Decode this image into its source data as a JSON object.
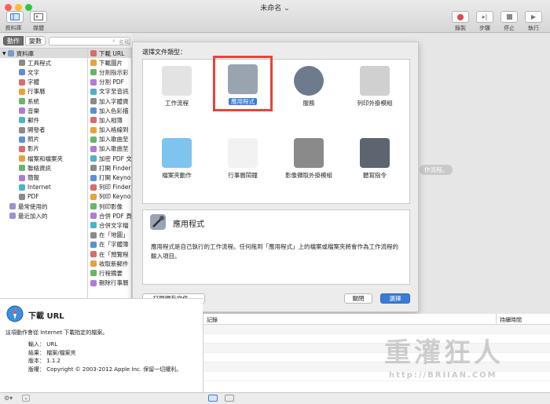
{
  "window": {
    "title": "未命名"
  },
  "toolbar": {
    "library_label": "資料庫",
    "media_label": "媒體",
    "record_label": "錄製",
    "step_label": "步驟",
    "stop_label": "停止",
    "run_label": "執行"
  },
  "sidebar": {
    "tab_actions": "動作",
    "tab_variables": "變數",
    "search_placeholder": "名稱",
    "root_label": "資料庫",
    "categories": [
      {
        "label": "工具程式",
        "icon": "utility-icon"
      },
      {
        "label": "文字",
        "icon": "text-icon"
      },
      {
        "label": "字體",
        "icon": "font-icon"
      },
      {
        "label": "行事曆",
        "icon": "calendar-icon"
      },
      {
        "label": "系統",
        "icon": "system-icon"
      },
      {
        "label": "音樂",
        "icon": "music-icon"
      },
      {
        "label": "郵件",
        "icon": "mail-icon"
      },
      {
        "label": "開發者",
        "icon": "developer-icon"
      },
      {
        "label": "照片",
        "icon": "photo-icon"
      },
      {
        "label": "影片",
        "icon": "movie-icon"
      },
      {
        "label": "檔案和檔案夾",
        "icon": "finder-icon"
      },
      {
        "label": "聯絡資訊",
        "icon": "contacts-icon"
      },
      {
        "label": "簡報",
        "icon": "presentation-icon"
      },
      {
        "label": "Internet",
        "icon": "internet-icon"
      },
      {
        "label": "PDF",
        "icon": "pdf-icon"
      }
    ],
    "smart": [
      {
        "label": "最常使用的",
        "icon": "folder-icon"
      },
      {
        "label": "最近加入的",
        "icon": "folder-icon"
      }
    ],
    "actions": [
      "下載 URL",
      "下載圖片",
      "分割指示彩",
      "分割 PDF",
      "文字至音訊",
      "加入字體資",
      "加入色彩描",
      "加入相簿",
      "加入格線到",
      "加入歌曲至",
      "加入歌曲至",
      "加密 PDF 文",
      "打開 Finder",
      "打開 Keyno",
      "列印 Finder",
      "列印 Keyno",
      "列印影像",
      "合併 PDF 頁",
      "合併文字檔",
      "在「地圖」",
      "在「字體簿",
      "在「預覽程",
      "收取新郵件",
      "行程摘要",
      "刪除行事曆"
    ]
  },
  "dialog": {
    "heading": "選擇文件類型：",
    "types": [
      {
        "label": "工作流程",
        "icon": "workflow-icon"
      },
      {
        "label": "應用程式",
        "icon": "application-icon",
        "selected": true
      },
      {
        "label": "服務",
        "icon": "gear-icon"
      },
      {
        "label": "列印外掛模組",
        "icon": "printer-icon"
      },
      {
        "label": "檔案夾動作",
        "icon": "folder-icon"
      },
      {
        "label": "行事曆鬧鐘",
        "icon": "calendar-icon"
      },
      {
        "label": "影像擷取外掛模組",
        "icon": "camera-icon"
      },
      {
        "label": "聽寫指令",
        "icon": "microphone-icon"
      }
    ],
    "desc_title": "應用程式",
    "desc_text": "應用程式是自己執行的工作流程。任何拖到「應用程式」上的檔案或檔案夾將會作為工作流程的輸入項目。",
    "open_existing": "打開現有文件⋯",
    "close": "關閉",
    "choose": "選擇",
    "behind_hint": "作流程。"
  },
  "info": {
    "title": "下載 URL",
    "summary": "這項動作會從 Internet 下載指定的檔案。",
    "input_label": "輸入：",
    "input_value": "URL",
    "result_label": "結果：",
    "result_value": "檔案/檔案夾",
    "version_label": "版本：",
    "version_value": "1.1.2",
    "copyright_label": "版權：",
    "copyright_value": "Copyright © 2003-2012 Apple Inc. 保留一切權利。"
  },
  "log": {
    "col_log": "記錄",
    "col_duration": "持續時間"
  },
  "watermark": {
    "title": "重灌狂人",
    "url": "http://BRIIAN.COM"
  },
  "colors": {
    "accent": "#3a7bd5",
    "selected_border": "#e8433a"
  }
}
